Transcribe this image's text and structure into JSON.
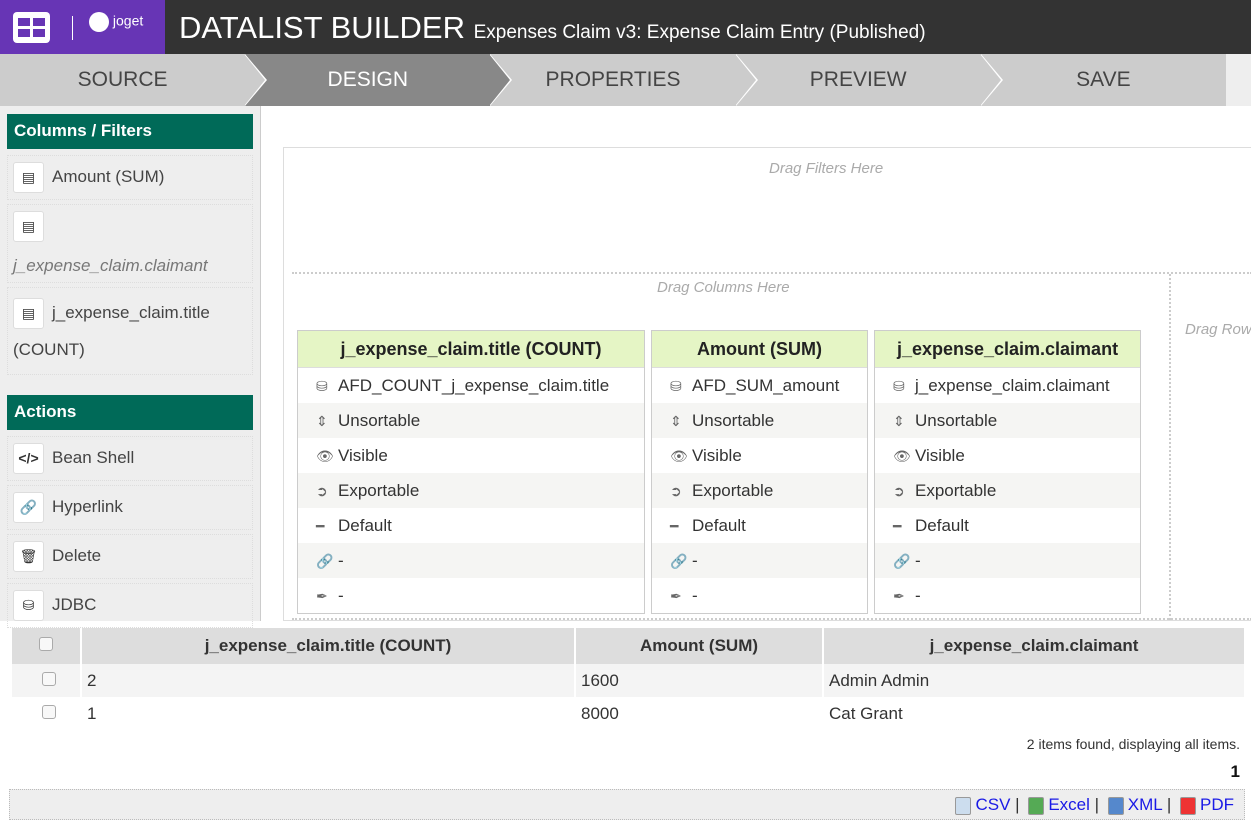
{
  "header": {
    "logo_text": "joget",
    "title": "DATALIST BUILDER",
    "subtitle": "Expenses Claim v3: Expense Claim Entry (Published)"
  },
  "steps": [
    {
      "label": "SOURCE"
    },
    {
      "label": "DESIGN"
    },
    {
      "label": "PROPERTIES"
    },
    {
      "label": "PREVIEW"
    },
    {
      "label": "SAVE"
    }
  ],
  "sidebar": {
    "columns_title": "Columns / Filters",
    "columns": [
      {
        "label": "Amount (SUM)"
      },
      {
        "label": "j_expense_claim.claimant"
      },
      {
        "label": "j_expense_claim.title (COUNT)"
      }
    ],
    "actions_title": "Actions",
    "actions": [
      {
        "label": "Bean Shell"
      },
      {
        "label": "Hyperlink"
      },
      {
        "label": "Delete"
      },
      {
        "label": "JDBC"
      }
    ]
  },
  "canvas": {
    "drag_filters": "Drag Filters Here",
    "drag_columns": "Drag Columns Here",
    "drag_rows": "Drag Row"
  },
  "cards": [
    {
      "title": "j_expense_claim.title (COUNT)",
      "rows": [
        "AFD_COUNT_j_expense_claim.title",
        "Unsortable",
        "Visible",
        "Exportable",
        "Default",
        "-",
        "-"
      ]
    },
    {
      "title": "Amount (SUM)",
      "rows": [
        "AFD_SUM_amount",
        "Unsortable",
        "Visible",
        "Exportable",
        "Default",
        "-",
        "-"
      ]
    },
    {
      "title": "j_expense_claim.claimant",
      "rows": [
        "j_expense_claim.claimant",
        "Unsortable",
        "Visible",
        "Exportable",
        "Default",
        "-",
        "-"
      ]
    }
  ],
  "table": {
    "headers": [
      "j_expense_claim.title (COUNT)",
      "Amount (SUM)",
      "j_expense_claim.claimant"
    ],
    "rows": [
      [
        "2",
        "1600",
        "Admin Admin"
      ],
      [
        "1",
        "8000",
        "Cat Grant"
      ]
    ],
    "found": "2 items found, displaying all items.",
    "page": "1"
  },
  "export": {
    "csv": "CSV",
    "excel": "Excel",
    "xml": "XML",
    "pdf": "PDF",
    "sep": "|"
  }
}
